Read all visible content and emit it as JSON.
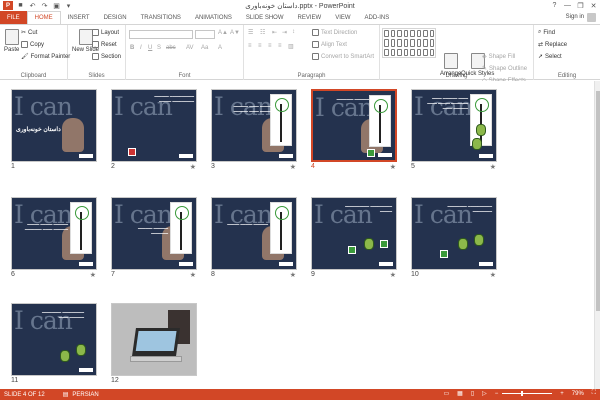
{
  "window": {
    "title": "داستان خونه‌باوری.pptx - PowerPoint",
    "app_badge": "P",
    "controls": [
      "?",
      "—",
      "❐",
      "✕"
    ]
  },
  "quick_access": [
    {
      "icon": "save-icon",
      "glyph": "■"
    },
    {
      "icon": "undo-icon",
      "glyph": "↶"
    },
    {
      "icon": "redo-icon",
      "glyph": "↷"
    },
    {
      "icon": "start-slideshow-icon",
      "glyph": "▣"
    },
    {
      "icon": "customize-qat-icon",
      "glyph": "▾"
    }
  ],
  "tabs": [
    "FILE",
    "HOME",
    "INSERT",
    "DESIGN",
    "TRANSITIONS",
    "ANIMATIONS",
    "SLIDE SHOW",
    "REVIEW",
    "VIEW",
    "ADD-INS"
  ],
  "active_tab": "HOME",
  "account": {
    "signin": "Sign in"
  },
  "ribbon": {
    "clipboard": {
      "label": "Clipboard",
      "paste": "Paste",
      "cut": "Cut",
      "copy": "Copy",
      "format_painter": "Format Painter"
    },
    "slides": {
      "label": "Slides",
      "new_slide": "New Slide",
      "layout": "Layout",
      "reset": "Reset",
      "section": "Section"
    },
    "font": {
      "label": "Font"
    },
    "paragraph": {
      "label": "Paragraph",
      "text_direction": "Text Direction",
      "align_text": "Align Text",
      "convert_smartart": "Convert to SmartArt"
    },
    "drawing": {
      "label": "Drawing",
      "arrange": "Arrange",
      "quick_styles": "Quick Styles",
      "shape_fill": "Shape Fill",
      "shape_outline": "Shape Outline",
      "shape_effects": "Shape Effects"
    },
    "editing": {
      "label": "Editing",
      "find": "Find",
      "replace": "Replace",
      "select": "Select"
    }
  },
  "slides": [
    {
      "num": "1",
      "title": "داستان خونه‌باوری"
    },
    {
      "num": "2"
    },
    {
      "num": "3"
    },
    {
      "num": "4",
      "selected": true
    },
    {
      "num": "5"
    },
    {
      "num": "6"
    },
    {
      "num": "7"
    },
    {
      "num": "8"
    },
    {
      "num": "9"
    },
    {
      "num": "10"
    },
    {
      "num": "11"
    },
    {
      "num": "12"
    }
  ],
  "star_glyph": "★",
  "status": {
    "slide": "SLIDE 4 OF 12",
    "language": "PERSIAN",
    "zoom": "79%",
    "zoom_level": 0.79
  },
  "colors": {
    "accent": "#d24726",
    "slide_bg": "#24324e"
  }
}
